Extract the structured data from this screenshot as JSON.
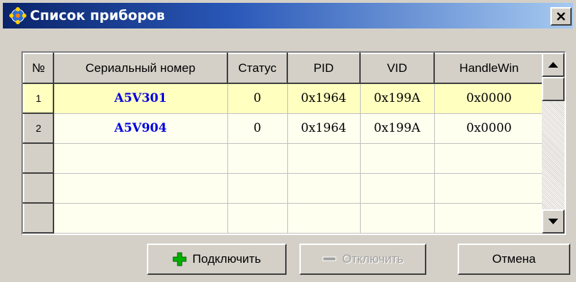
{
  "window": {
    "title": "Список приборов",
    "title_icon": "devices-icon",
    "close_icon": "close-icon"
  },
  "grid": {
    "columns": [
      "№",
      "Сериальный номер",
      "Статус",
      "PID",
      "VID",
      "HandleWin"
    ],
    "rows": [
      {
        "num": "1",
        "serial": "A5V301",
        "status": "0",
        "pid": "0x1964",
        "vid": "0x199A",
        "handle": "0x0000"
      },
      {
        "num": "2",
        "serial": "A5V904",
        "status": "0",
        "pid": "0x1964",
        "vid": "0x199A",
        "handle": "0x0000"
      },
      {
        "num": "",
        "serial": "",
        "status": "",
        "pid": "",
        "vid": "",
        "handle": ""
      },
      {
        "num": "",
        "serial": "",
        "status": "",
        "pid": "",
        "vid": "",
        "handle": ""
      },
      {
        "num": "",
        "serial": "",
        "status": "",
        "pid": "",
        "vid": "",
        "handle": ""
      }
    ],
    "selected_row": 1
  },
  "buttons": {
    "connect": {
      "label": "Подключить",
      "icon": "plus-icon",
      "color": "#00b000"
    },
    "disconnect": {
      "label": "Отключить",
      "icon": "minus-icon",
      "disabled": true
    },
    "cancel": {
      "label": "Отмена"
    }
  }
}
